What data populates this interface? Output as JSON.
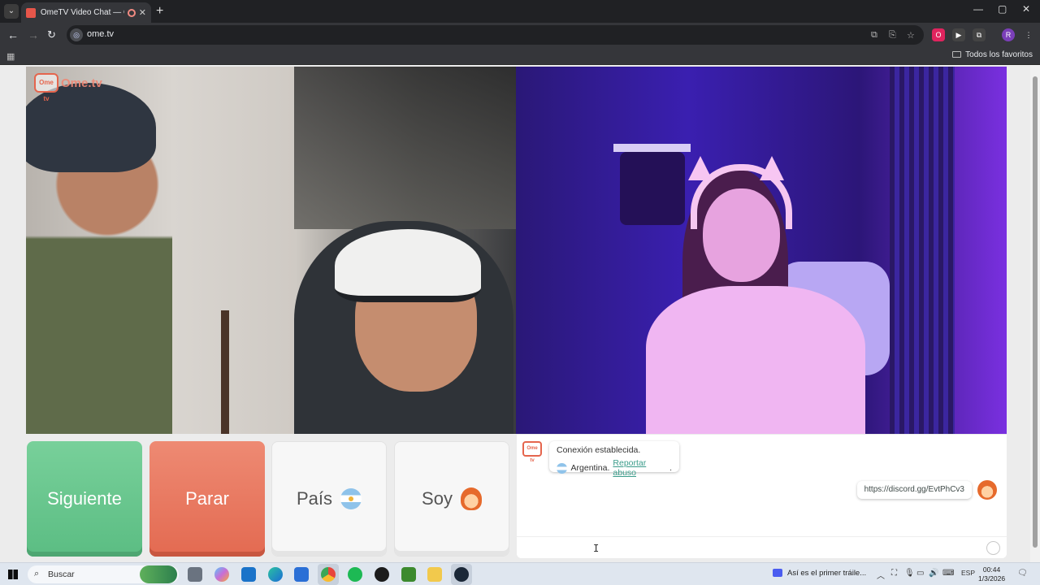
{
  "browser": {
    "tab_title": "OmeTV Video Chat — Ome",
    "url": "ome.tv",
    "bookmarks_label": "Todos los favoritos",
    "window_controls": [
      "—",
      "▢",
      "✕"
    ]
  },
  "page": {
    "logo_text": "Ome.tv",
    "logo_badge": "Ome tv",
    "buttons": {
      "next": "Siguiente",
      "stop": "Parar",
      "country": "País",
      "me": "Soy"
    },
    "chat": {
      "status": "Conexión establecida.",
      "country": "Argentina.",
      "report_link": "Reportar abuso",
      "report_suffix": ".",
      "my_message": "https://discord.gg/EvtPhCv3"
    }
  },
  "taskbar": {
    "search_placeholder": "Buscar",
    "news_text": "Así es el primer tráile...",
    "language": "ESP",
    "time": "00:44",
    "date": "1/3/2026"
  },
  "icons": [
    "windows-icon",
    "search-icon",
    "task-view-icon",
    "copilot-icon",
    "outlook-icon",
    "edge-icon",
    "store-icon",
    "chrome-icon",
    "spotify-icon",
    "app-icon",
    "minecraft-icon",
    "files-icon",
    "steam-icon"
  ]
}
